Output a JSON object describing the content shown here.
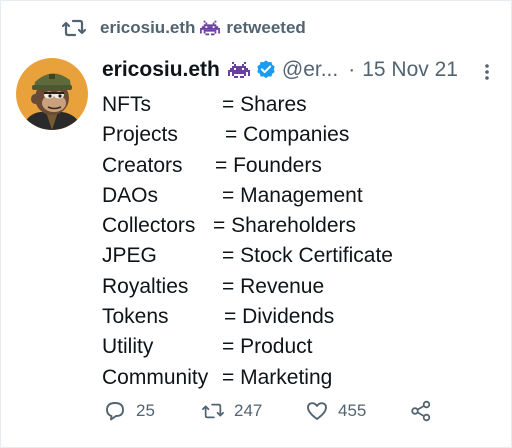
{
  "retweet": {
    "icon": "retweet-icon",
    "user": "ericosiu.eth",
    "emoji": "space-invader-emoji",
    "action": "retweeted"
  },
  "tweet": {
    "avatar": "bored-ape-avatar",
    "name": "ericosiu.eth",
    "name_emoji": "space-invader-emoji",
    "verified_icon": "verified-badge-icon",
    "handle": "@er...",
    "separator": "·",
    "date": "15 Nov 21",
    "more_icon": "vertical-ellipsis-icon",
    "lines": [
      {
        "term": "NFTs",
        "eq": "= Shares"
      },
      {
        "term": "Projects",
        "eq": "= Companies"
      },
      {
        "term": "Creators",
        "eq": "= Founders"
      },
      {
        "term": "DAOs",
        "eq": "= Management"
      },
      {
        "term": "Collectors",
        "eq": "= Shareholders"
      },
      {
        "term": "JPEG",
        "eq": "= Stock Certificate"
      },
      {
        "term": "Royalties",
        "eq": "= Revenue"
      },
      {
        "term": "Tokens",
        "eq": "= Dividends"
      },
      {
        "term": "Utility",
        "eq": "= Product"
      },
      {
        "term": "Community",
        "eq": "= Marketing"
      }
    ]
  },
  "actions": {
    "replies": {
      "icon": "reply-icon",
      "count": "25"
    },
    "retweets": {
      "icon": "retweet-icon",
      "count": "247"
    },
    "likes": {
      "icon": "heart-icon",
      "count": "455"
    },
    "share": {
      "icon": "share-icon"
    }
  },
  "colors": {
    "text": "#0f1419",
    "muted": "#536471",
    "verified": "#1d9bf0",
    "emoji_purple": "#6b3fa0"
  }
}
